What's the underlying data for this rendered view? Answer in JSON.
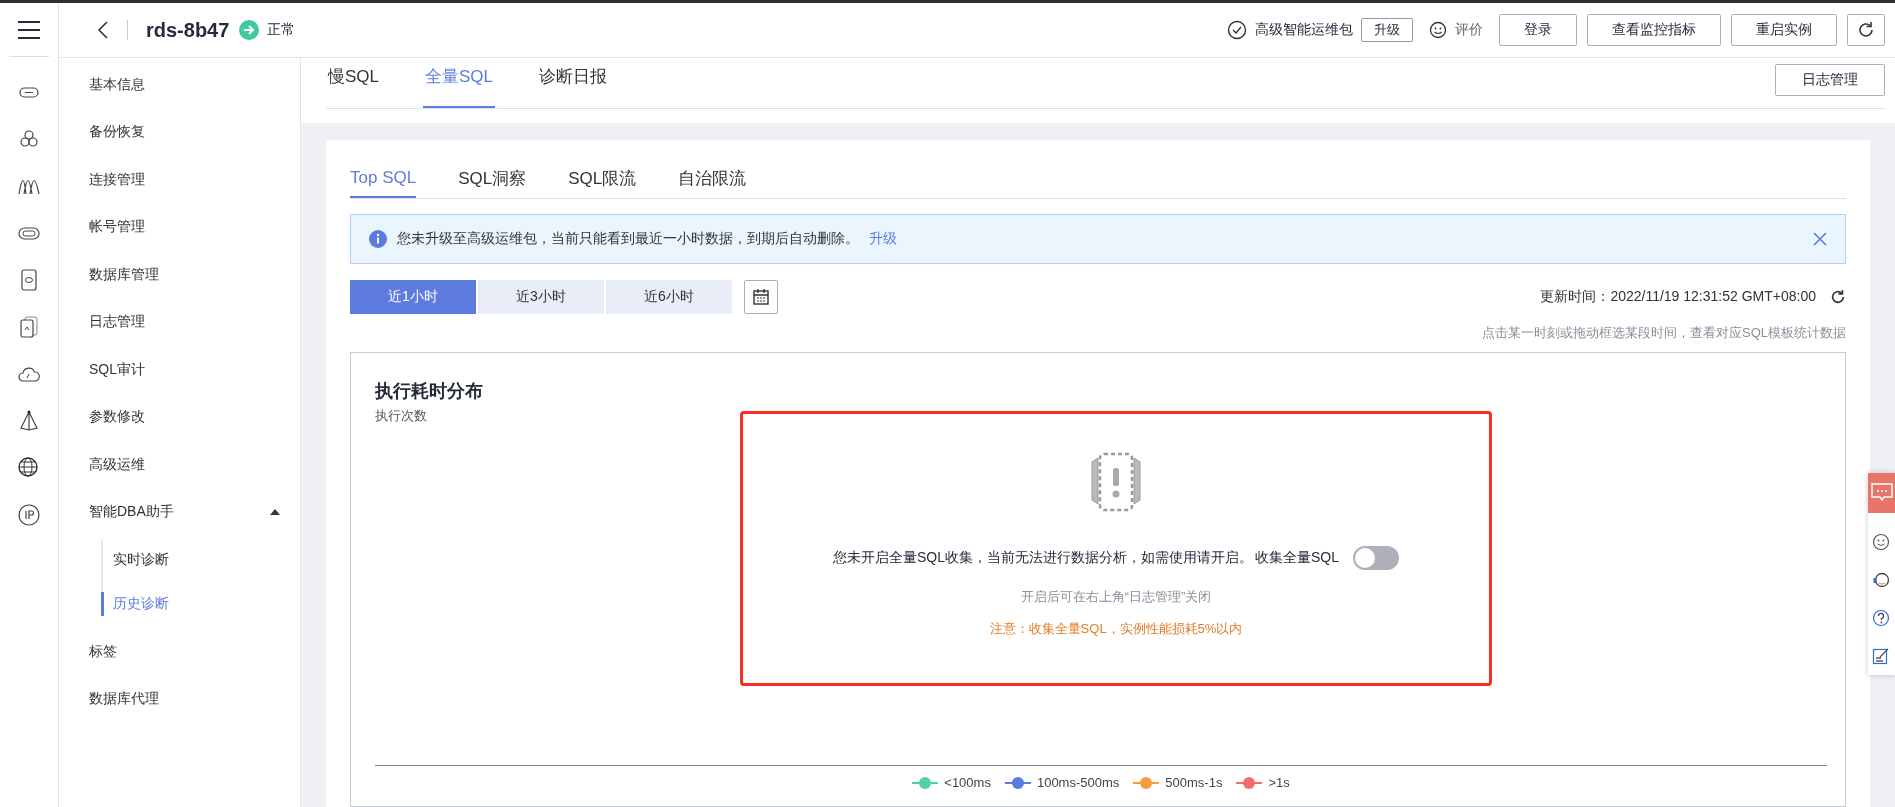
{
  "header": {
    "title": "rds-8b47",
    "status": "正常",
    "package": "高级智能运维包",
    "upgrade": "升级",
    "rate": "评价",
    "buttons": [
      "登录",
      "查看监控指标",
      "重启实例"
    ]
  },
  "sidebar": {
    "items": [
      {
        "label": "基本信息",
        "selected": false
      },
      {
        "label": "备份恢复",
        "selected": false
      },
      {
        "label": "连接管理",
        "selected": false
      },
      {
        "label": "帐号管理",
        "selected": false
      },
      {
        "label": "数据库管理",
        "selected": false
      },
      {
        "label": "日志管理",
        "selected": false
      },
      {
        "label": "SQL审计",
        "selected": false
      },
      {
        "label": "参数修改",
        "selected": false
      },
      {
        "label": "高级运维",
        "selected": false
      },
      {
        "label": "智能DBA助手",
        "selected": false,
        "expanded": true,
        "children": [
          {
            "label": "实时诊断",
            "selected": false
          },
          {
            "label": "历史诊断",
            "selected": true
          }
        ]
      },
      {
        "label": "标签",
        "selected": false
      },
      {
        "label": "数据库代理",
        "selected": false
      }
    ]
  },
  "page_tabs": [
    {
      "label": "慢SQL",
      "selected": false
    },
    {
      "label": "全量SQL",
      "selected": true
    },
    {
      "label": "诊断日报",
      "selected": false
    }
  ],
  "log_button": "日志管理",
  "sub_tabs": [
    {
      "label": "Top SQL",
      "selected": true
    },
    {
      "label": "SQL洞察",
      "selected": false
    },
    {
      "label": "SQL限流",
      "selected": false
    },
    {
      "label": "自治限流",
      "selected": false
    }
  ],
  "alert": {
    "text": "您未升级至高级运维包，当前只能看到最近一小时数据，到期后自动删除。",
    "link": "升级"
  },
  "time_ranges": [
    {
      "label": "近1小时",
      "selected": true
    },
    {
      "label": "近3小时",
      "selected": false
    },
    {
      "label": "近6小时",
      "selected": false
    }
  ],
  "update_time": "更新时间：2022/11/19 12:31:52 GMT+08:00",
  "hint": "点击某一时刻或拖动框选某段时间，查看对应SQL模板统计数据",
  "chart": {
    "title": "执行耗时分布",
    "ylabel": "执行次数",
    "empty_message": "您未开启全量SQL收集，当前无法进行数据分析，如需使用请开启。",
    "toggle": {
      "label": "收集全量SQL",
      "on": false
    },
    "note": "开启后可在右上角“日志管理”关闭",
    "warning": "注意：收集全量SQL，实例性能损耗5%以内",
    "legend": [
      {
        "label": "<100ms",
        "color": "#4fd1a5"
      },
      {
        "label": "100ms-500ms",
        "color": "#5b7be0"
      },
      {
        "label": "500ms-1s",
        "color": "#fa9a3f"
      },
      {
        "label": ">1s",
        "color": "#f56c6c"
      }
    ]
  }
}
